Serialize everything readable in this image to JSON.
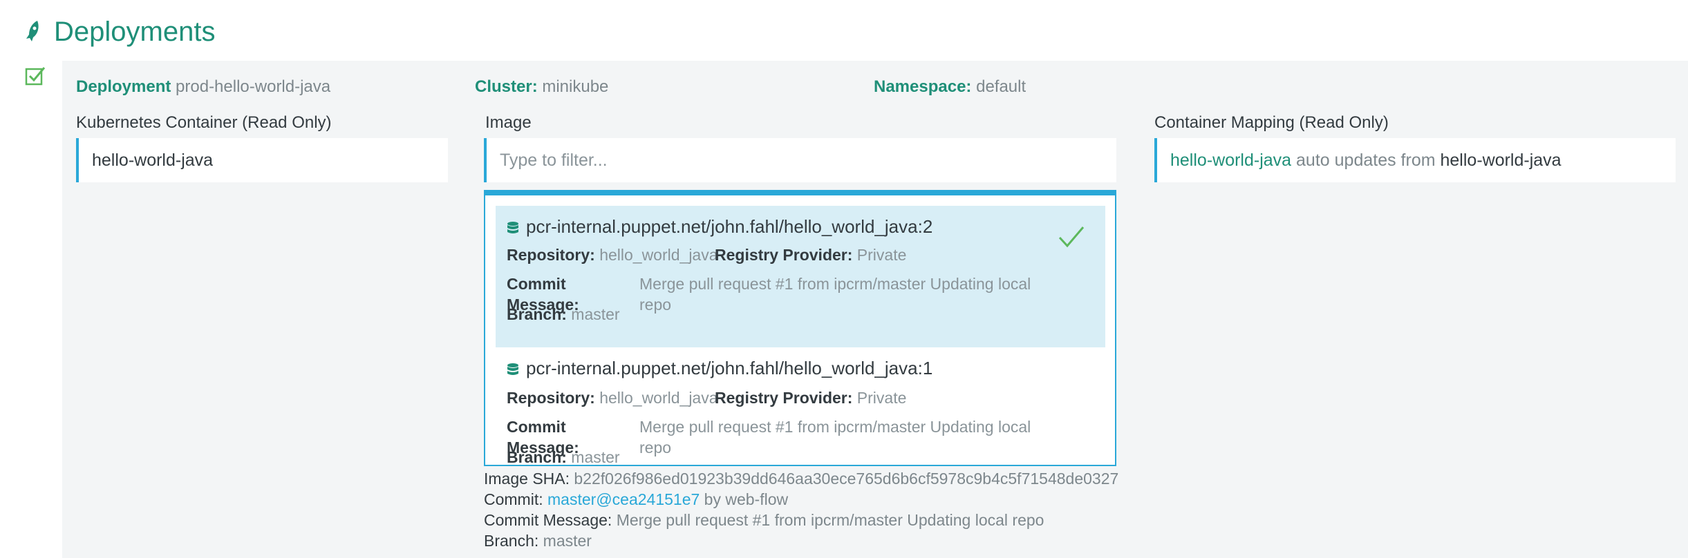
{
  "header": {
    "title": "Deployments",
    "icon": "rocket-icon"
  },
  "deployment": {
    "deployment_label": "Deployment",
    "deployment_value": "prod-hello-world-java",
    "cluster_label": "Cluster:",
    "cluster_value": "minikube",
    "namespace_label": "Namespace:",
    "namespace_value": "default"
  },
  "container": {
    "label": "Kubernetes Container (Read Only)",
    "value": "hello-world-java"
  },
  "image": {
    "label": "Image",
    "placeholder": "Type to filter...",
    "options": [
      {
        "title": "pcr-internal.puppet.net/john.fahl/hello_world_java:2",
        "repository_label": "Repository:",
        "repository": "hello_world_java",
        "registry_label": "Registry Provider:",
        "registry": "Private",
        "commit_message_label": "Commit Message:",
        "commit_message": "Merge pull request #1 from ipcrm/master Updating local repo",
        "branch_label": "Branch:",
        "branch": "master",
        "selected": true
      },
      {
        "title": "pcr-internal.puppet.net/john.fahl/hello_world_java:1",
        "repository_label": "Repository:",
        "repository": "hello_world_java",
        "registry_label": "Registry Provider:",
        "registry": "Private",
        "commit_message_label": "Commit Message:",
        "commit_message": "Merge pull request #1 from ipcrm/master Updating local repo",
        "branch_label": "Branch:",
        "branch": "master",
        "selected": false
      }
    ],
    "details": {
      "sha_label": "Image SHA:",
      "sha": "b22f026f986ed01923b39dd646aa30ece765d6b6cf5978c9b4c5f71548de0327",
      "commit_label": "Commit:",
      "commit_link": "master@cea24151e7",
      "commit_by": "by web-flow",
      "commit_message_label": "Commit Message:",
      "commit_message": "Merge pull request #1 from ipcrm/master Updating local repo",
      "branch_label": "Branch:",
      "branch": "master"
    }
  },
  "mapping": {
    "label": "Container Mapping (Read Only)",
    "container": "hello-world-java",
    "connector": "auto updates from",
    "source": "hello-world-java"
  },
  "colors": {
    "accent": "#1f8f78",
    "link": "#2aa8d8",
    "selected_bg": "#d8eef6",
    "check": "#5cb85c"
  }
}
